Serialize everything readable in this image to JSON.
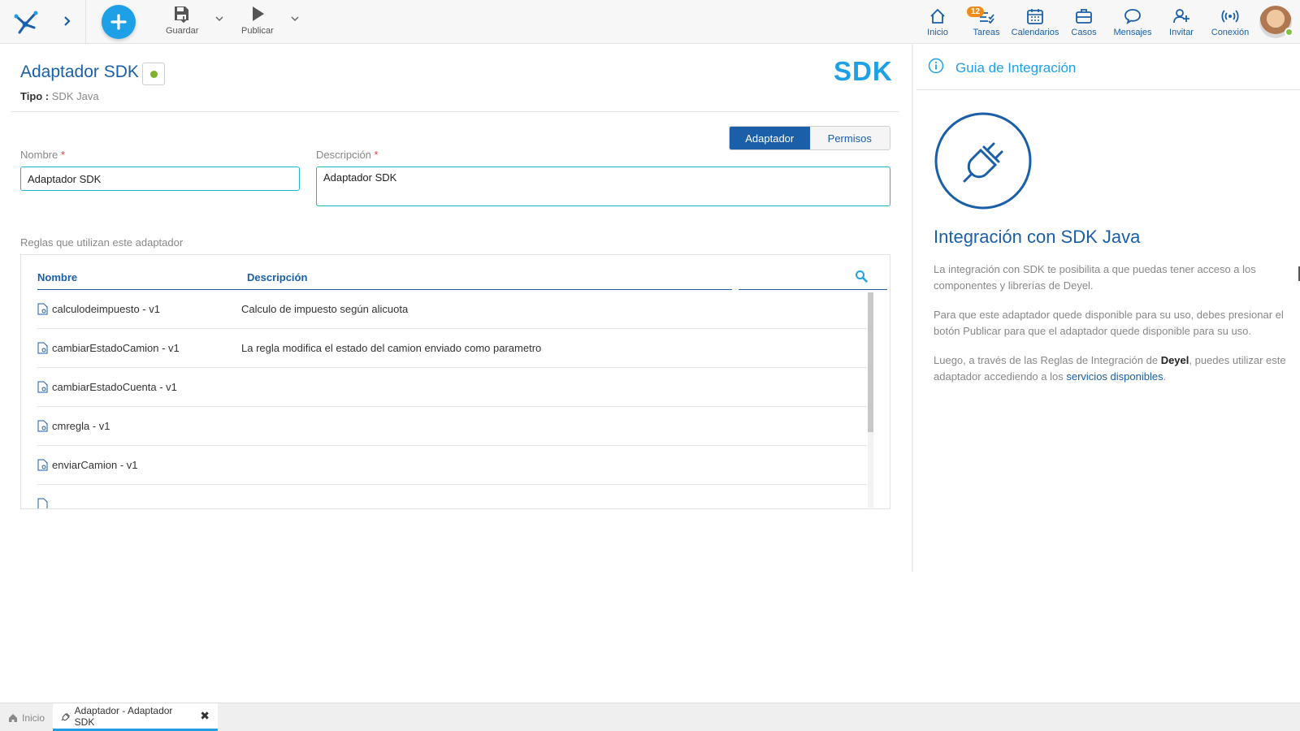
{
  "toolbar": {
    "save_label": "Guardar",
    "publish_label": "Publicar"
  },
  "nav": {
    "items": [
      {
        "label": "Inicio",
        "icon": "home-icon"
      },
      {
        "label": "Tareas",
        "icon": "tasks-icon",
        "badge": "12"
      },
      {
        "label": "Calendarios",
        "icon": "calendar-icon"
      },
      {
        "label": "Casos",
        "icon": "briefcase-icon"
      },
      {
        "label": "Mensajes",
        "icon": "chat-icon"
      },
      {
        "label": "Invitar",
        "icon": "add-user-icon"
      },
      {
        "label": "Conexión",
        "icon": "connection-icon"
      }
    ]
  },
  "header": {
    "title": "Adaptador SDK",
    "tipo_label": "Tipo :",
    "tipo_value": "SDK Java",
    "logo_text": "SDK"
  },
  "tabs": {
    "adaptador": "Adaptador",
    "permisos": "Permisos"
  },
  "form": {
    "nombre_label": "Nombre",
    "nombre_value": "Adaptador SDK",
    "descripcion_label": "Descripción",
    "descripcion_value": "Adaptador SDK",
    "required_mark": "*"
  },
  "rules": {
    "section_label": "Reglas que utilizan este adaptador",
    "col_nombre": "Nombre",
    "col_descripcion": "Descripción",
    "rows": [
      {
        "name": "calculodeimpuesto - v1",
        "desc": "Calculo de impuesto según alicuota"
      },
      {
        "name": "cambiarEstadoCamion - v1",
        "desc": "La regla modifica el estado del camion enviado como parametro"
      },
      {
        "name": "cambiarEstadoCuenta - v1",
        "desc": ""
      },
      {
        "name": "cmregla - v1",
        "desc": ""
      },
      {
        "name": "enviarCamion - v1",
        "desc": ""
      },
      {
        "name": "",
        "desc": ""
      }
    ]
  },
  "guide": {
    "title": "Guia de Integración",
    "heading": "Integración con SDK Java",
    "p1": "La integración con SDK te posibilita a que puedas tener acceso a los componentes y librerías de Deyel.",
    "p2": "Para que este adaptador quede disponible para su uso, debes presionar el botón Publicar para que el adaptador quede disponible para su uso.",
    "p3_a": "Luego, a través de las Reglas de Integración de ",
    "p3_brand": "Deyel",
    "p3_b": ", puedes utilizar este adaptador accediendo a los ",
    "p3_link": "servicios disponibles",
    "p3_c": "."
  },
  "bottom_tabs": {
    "home": "Inicio",
    "current": "Adaptador - Adaptador SDK"
  },
  "colors": {
    "primary": "#1a5fa8",
    "accent": "#1ea0e6",
    "input_border": "#27b5c8",
    "status_green": "#7fb32a",
    "badge": "#f08c1a"
  }
}
